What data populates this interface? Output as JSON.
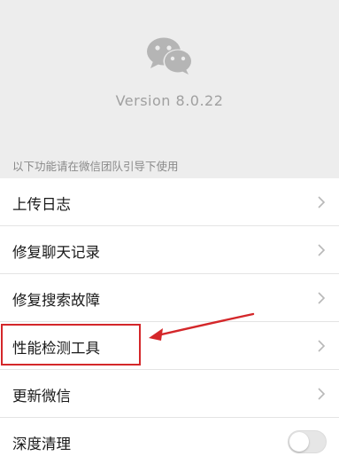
{
  "header": {
    "logo_icon": "wechat-logo-icon",
    "version": "Version 8.0.22"
  },
  "hint": "以下功能请在微信团队引导下使用",
  "list": {
    "items": [
      {
        "label": "上传日志",
        "control": "chevron"
      },
      {
        "label": "修复聊天记录",
        "control": "chevron"
      },
      {
        "label": "修复搜索故障",
        "control": "chevron"
      },
      {
        "label": "性能检测工具",
        "control": "chevron"
      },
      {
        "label": "更新微信",
        "control": "chevron"
      },
      {
        "label": "深度清理",
        "control": "toggle",
        "toggle_on": false
      }
    ]
  },
  "annotation": {
    "highlight_color": "#d4272a",
    "highlighted_item": "性能检测工具"
  },
  "colors": {
    "background": "#ededed",
    "row_background": "#ffffff",
    "muted_text": "#a0a0a0"
  }
}
